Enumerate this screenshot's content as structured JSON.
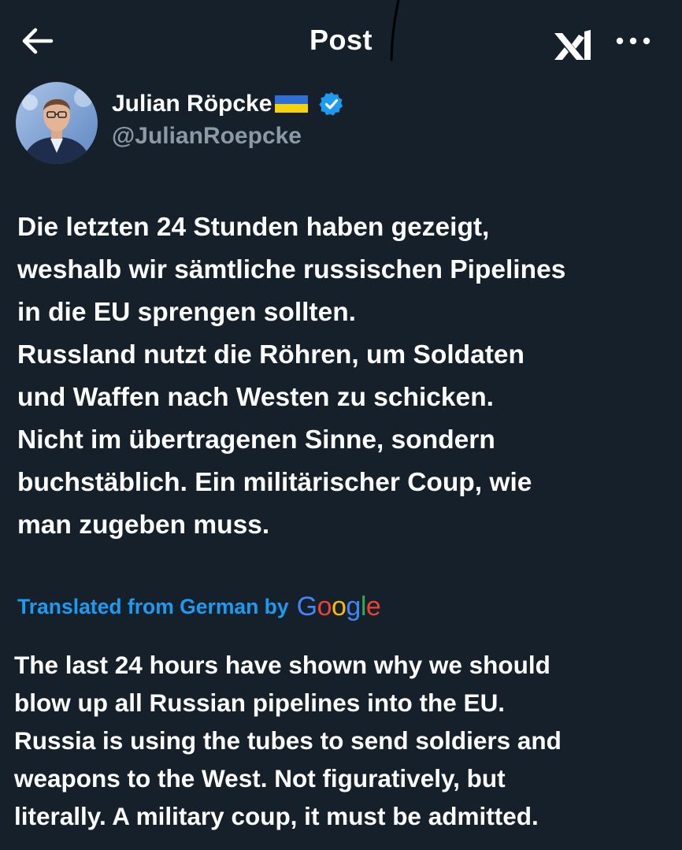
{
  "header": {
    "title": "Post",
    "back_icon": "arrow-left-icon",
    "grok_icon": "grok-icon",
    "more_icon": "more-dots-icon"
  },
  "author": {
    "name": "Julian Röpcke",
    "handle": "@JulianRoepcke",
    "flag_icon": "ukraine-flag-icon",
    "verified_icon": "verified-badge-icon",
    "verified_color": "#1d9bf0"
  },
  "post": {
    "text": "Die letzten 24 Stunden haben gezeigt,\nweshalb wir sämtliche russischen Pipelines\nin die EU sprengen sollten.\nRussland nutzt die Röhren, um Soldaten\nund Waffen nach Westen zu schicken.\nNicht im übertragenen Sinne, sondern\nbuchstäblich. Ein militärischer Coup, wie\nman zugeben muss."
  },
  "translation": {
    "label": "Translated from German by",
    "provider": "Google",
    "text": "The last 24 hours have shown why we should\nblow up all Russian pipelines into the EU.\nRussia is using the tubes to send soldiers and\nweapons to the West. Not figuratively, but\nliterally. A military coup, it must be admitted.",
    "link_color": "#1d9bf0"
  },
  "theme": {
    "background": "#15202b",
    "text": "#ffffff",
    "muted": "#8b98a5"
  }
}
